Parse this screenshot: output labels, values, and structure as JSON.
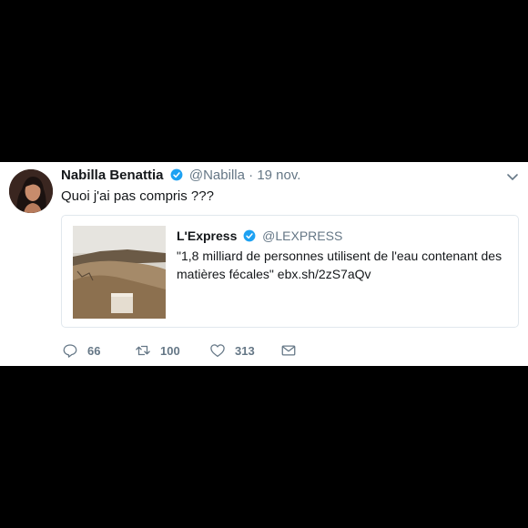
{
  "tweet": {
    "author_name": "Nabilla Benattia",
    "handle": "@Nabilla",
    "separator": "·",
    "date": "19 nov.",
    "text": "Quoi j'ai pas compris ???"
  },
  "quoted": {
    "author_name": "L'Express",
    "handle": "@LEXPRESS",
    "text": "\"1,8 milliard de personnes utilisent de l'eau contenant des matières fécales\" ebx.sh/2zS7aQv"
  },
  "actions": {
    "reply_count": "66",
    "retweet_count": "100",
    "like_count": "313"
  },
  "colors": {
    "verified": "#1da1f2",
    "muted": "#657786",
    "text": "#14171a",
    "border": "#e1e8ed"
  },
  "icons": [
    "verified-icon",
    "chevron-down-icon",
    "reply-icon",
    "retweet-icon",
    "like-icon",
    "message-icon"
  ]
}
